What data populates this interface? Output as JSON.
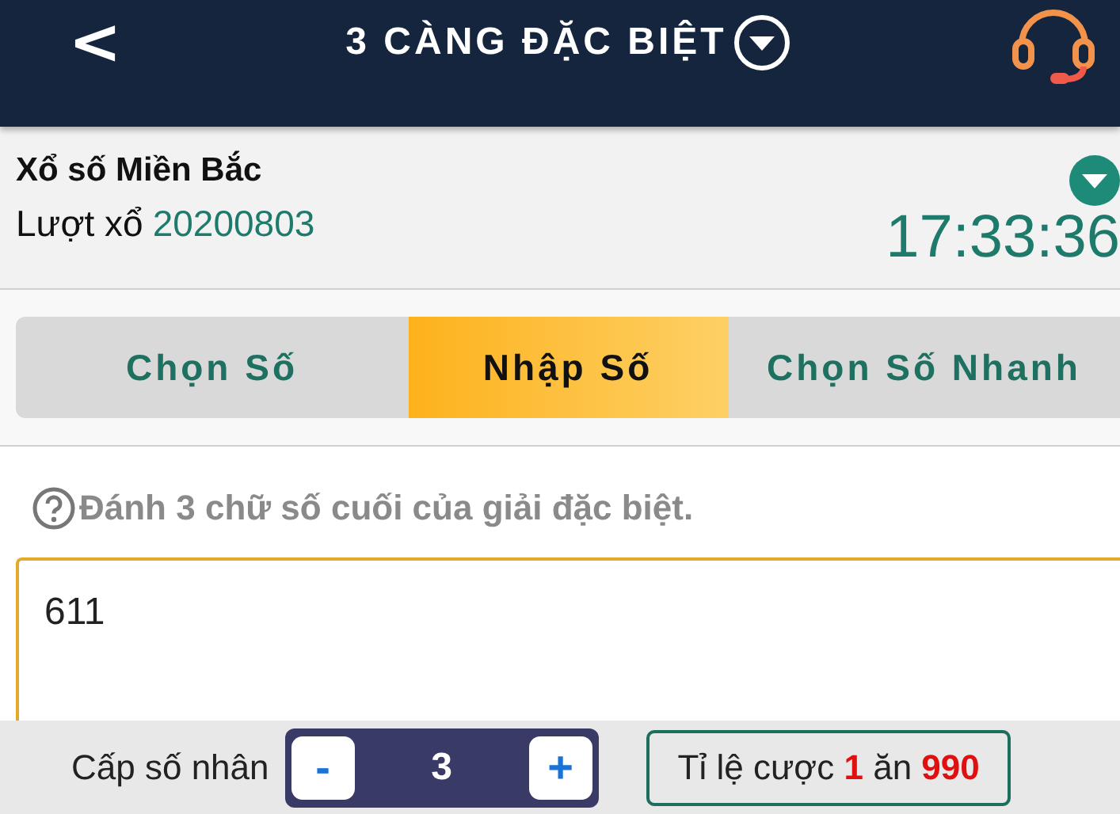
{
  "header": {
    "back": "<",
    "title": "3 CÀNG ĐẶC BIỆT"
  },
  "info": {
    "lottery": "Xổ số Miền Bắc",
    "round_label": "Lượt xổ",
    "round": "20200803",
    "countdown": "17:33:36"
  },
  "tabs": [
    {
      "label": "Chọn Số",
      "selected": false
    },
    {
      "label": "Nhập Số",
      "selected": true
    },
    {
      "label": "Chọn Số Nhanh",
      "selected": false
    }
  ],
  "hint": "Đánh 3 chữ số cuối của giải đặc biệt.",
  "entry": {
    "value": "611"
  },
  "footer": {
    "multiplier_label": "Cấp số nhân",
    "minus": "-",
    "multiplier": "3",
    "plus": "+",
    "odds": "Tỉ lệ cược **1** ăn **990**"
  }
}
